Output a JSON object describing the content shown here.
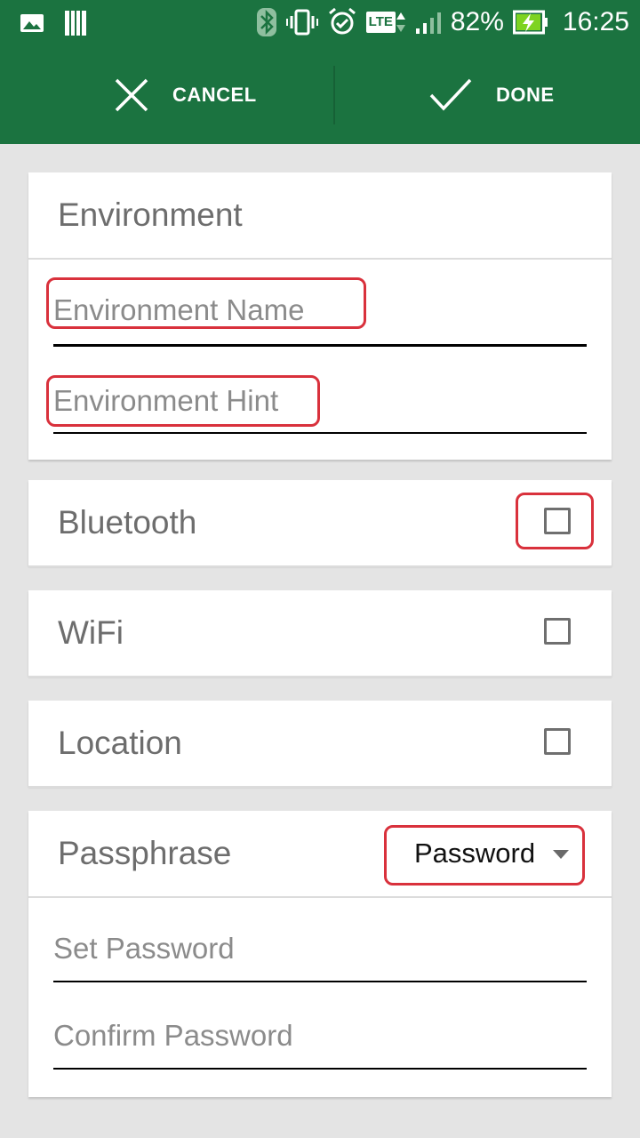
{
  "status_bar": {
    "battery": "82%",
    "time": "16:25",
    "network": "LTE",
    "icons": [
      "image-icon",
      "storage-icon",
      "bluetooth-icon",
      "vibrate-icon",
      "alarm-icon",
      "lte-icon",
      "signal-icon",
      "battery-charging-icon"
    ]
  },
  "toolbar": {
    "cancel_label": "CANCEL",
    "done_label": "DONE",
    "color": "#1b7340"
  },
  "environment": {
    "title": "Environment",
    "name_placeholder": "Environment Name",
    "hint_placeholder": "Environment Hint"
  },
  "options": [
    {
      "label": "Bluetooth",
      "checked": false
    },
    {
      "label": "WiFi",
      "checked": false
    },
    {
      "label": "Location",
      "checked": false
    }
  ],
  "passphrase": {
    "title": "Passphrase",
    "selected": "Password",
    "set_placeholder": "Set Password",
    "confirm_placeholder": "Confirm Password"
  },
  "highlight_color": "#d9313c"
}
